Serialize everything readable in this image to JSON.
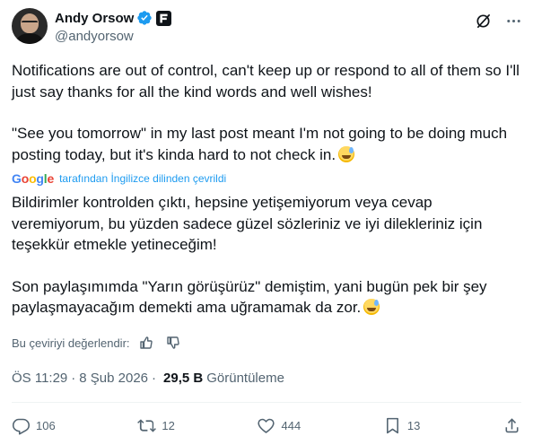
{
  "author": {
    "name": "Andy Orsow",
    "handle": "@andyorsow",
    "avatar_icon": "avatar-photo",
    "verified_color": "#1d9bf0"
  },
  "header_actions": [
    "grok-icon",
    "more-icon"
  ],
  "tweet": {
    "paragraph_1": "Notifications are out of control, can't keep up or respond to all of them so I'll just say thanks for all the kind words and well wishes!",
    "paragraph_2": "\"See you tomorrow\" in my last post meant I'm not going to be doing much posting today, but it's kinda hard to not check in."
  },
  "translation": {
    "provider": "Google",
    "label": "tarafından İngilizce dilinden çevrildi",
    "paragraph_1": "Bildirimler kontrolden çıktı, hepsine yetişemiyorum veya cevap veremiyorum, bu yüzden sadece güzel sözleriniz ve iyi dilekleriniz için teşekkür etmekle yetineceğim!",
    "paragraph_2": "Son paylaşımımda \"Yarın görüşürüz\" demiştim, yani bugün pek bir şey paylaşmayacağım demekti ama uğramamak da zor.",
    "rate_label": "Bu çeviriyi değerlendir:"
  },
  "meta": {
    "time": "ÖS 11:29",
    "separator": "·",
    "date": "8 Şub 2026",
    "views_count": "29,5 B",
    "views_label": "Görüntüleme"
  },
  "stats": {
    "replies": "106",
    "reposts": "12",
    "likes": "444",
    "bookmarks": "13"
  },
  "colors": {
    "text": "#0f1419",
    "secondary": "#536471",
    "link": "#1d9bf0"
  }
}
